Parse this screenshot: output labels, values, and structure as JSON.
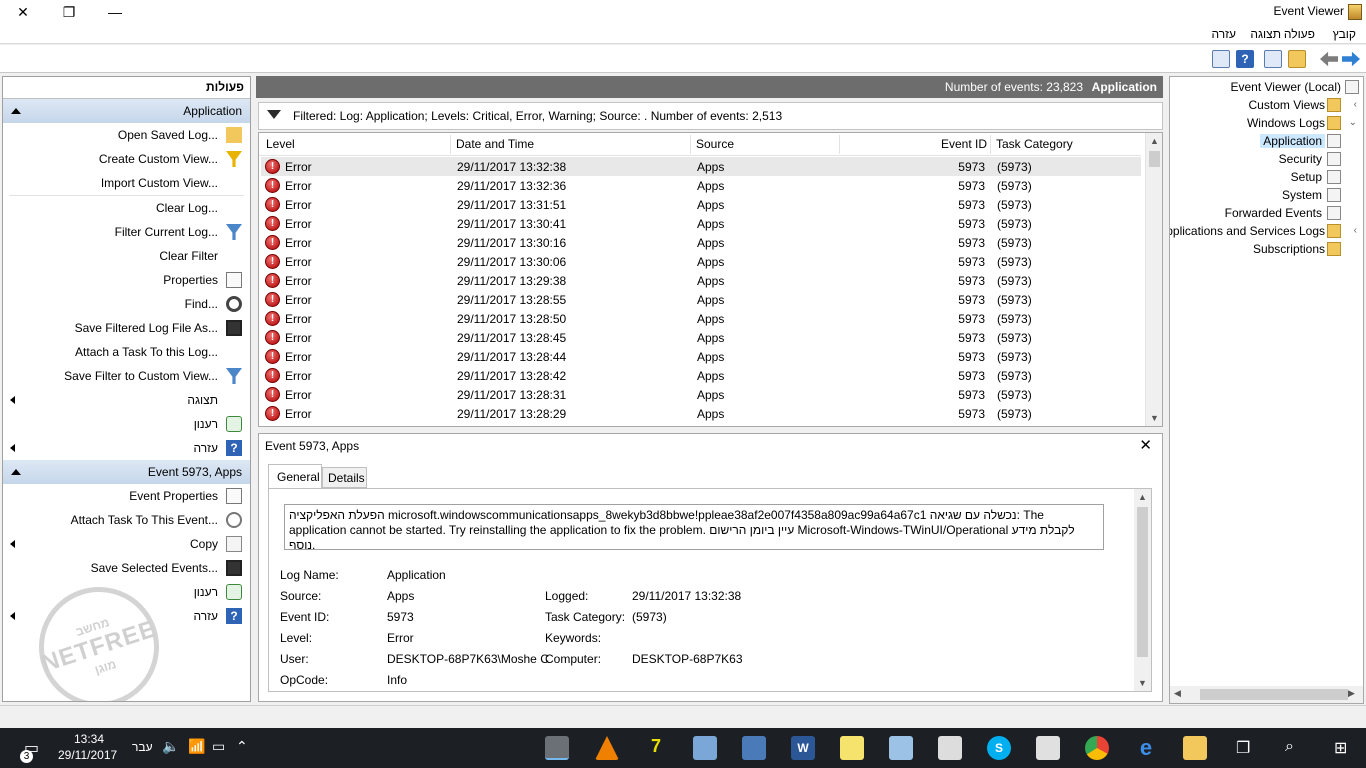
{
  "window": {
    "title": "Event Viewer",
    "minimize_glyph": "—",
    "restore_glyph": "❐",
    "close_glyph": "✕"
  },
  "menu": [
    "קובץ",
    "פעולה",
    "תצוגה",
    "עזרה"
  ],
  "actions": {
    "header": "פעולות",
    "section1_title": "Application",
    "section1_items": [
      "Open Saved Log...",
      "Create Custom View...",
      "Import Custom View...",
      "Clear Log...",
      "Filter Current Log...",
      "Clear Filter",
      "Properties",
      "Find...",
      "Save Filtered Log File As...",
      "Attach a Task To this Log...",
      "Save Filter to Custom View..."
    ],
    "view_label": "תצוגה",
    "refresh_label": "רענון",
    "help_label": "עזרה",
    "section2_title": "Event 5973, Apps",
    "section2_items": [
      "Event Properties",
      "Attach Task To This Event...",
      "Copy",
      "Save Selected Events..."
    ],
    "refresh2_label": "רענון",
    "help2_label": "עזרה",
    "watermark_top": "מחשב",
    "watermark_mid": "NETFREE",
    "watermark_bottom": "מוגן"
  },
  "log_header": {
    "count_text": "Number of events: 23,823",
    "log_name": "Application"
  },
  "filter_text": "Filtered: Log: Application; Levels: Critical, Error, Warning; Source: . Number of events: 2,513",
  "columns": [
    "Level",
    "Date and Time",
    "Source",
    "Event ID",
    "Task Category"
  ],
  "events": [
    [
      "Error",
      "29/11/2017 13:32:38",
      "Apps",
      "5973",
      "(5973)"
    ],
    [
      "Error",
      "29/11/2017 13:32:36",
      "Apps",
      "5973",
      "(5973)"
    ],
    [
      "Error",
      "29/11/2017 13:31:51",
      "Apps",
      "5973",
      "(5973)"
    ],
    [
      "Error",
      "29/11/2017 13:30:41",
      "Apps",
      "5973",
      "(5973)"
    ],
    [
      "Error",
      "29/11/2017 13:30:16",
      "Apps",
      "5973",
      "(5973)"
    ],
    [
      "Error",
      "29/11/2017 13:30:06",
      "Apps",
      "5973",
      "(5973)"
    ],
    [
      "Error",
      "29/11/2017 13:29:38",
      "Apps",
      "5973",
      "(5973)"
    ],
    [
      "Error",
      "29/11/2017 13:28:55",
      "Apps",
      "5973",
      "(5973)"
    ],
    [
      "Error",
      "29/11/2017 13:28:50",
      "Apps",
      "5973",
      "(5973)"
    ],
    [
      "Error",
      "29/11/2017 13:28:45",
      "Apps",
      "5973",
      "(5973)"
    ],
    [
      "Error",
      "29/11/2017 13:28:44",
      "Apps",
      "5973",
      "(5973)"
    ],
    [
      "Error",
      "29/11/2017 13:28:42",
      "Apps",
      "5973",
      "(5973)"
    ],
    [
      "Error",
      "29/11/2017 13:28:31",
      "Apps",
      "5973",
      "(5973)"
    ],
    [
      "Error",
      "29/11/2017 13:28:29",
      "Apps",
      "5973",
      "(5973)"
    ]
  ],
  "detail": {
    "title": "Event 5973, Apps",
    "tab_general": "General",
    "tab_details": "Details",
    "description": "הפעלת האפליקציה microsoft.windowscommunicationsapps_8wekyb3d8bbwe!ppleae38af2e007f4358a809ac99a64a67c1 נכשלה עם שגיאה: The application cannot be started. Try reinstalling the application to fix the problem. עיין ביומן הרישום Microsoft-Windows-TWinUI/Operational לקבלת מידע נוסף.",
    "log_name_label": "Log Name:",
    "log_name": "Application",
    "source_label": "Source:",
    "source": "Apps",
    "logged_label": "Logged:",
    "logged": "29/11/2017 13:32:38",
    "event_id_label": "Event ID:",
    "event_id": "5973",
    "task_category_label": "Task Category:",
    "task_category": "(5973)",
    "level_label": "Level:",
    "level": "Error",
    "keywords_label": "Keywords:",
    "user_label": "User:",
    "user": "DESKTOP-68P7K63\\Moshe C",
    "computer_label": "Computer:",
    "computer": "DESKTOP-68P7K63",
    "opcode_label": "OpCode:",
    "opcode": "Info"
  },
  "tree": {
    "root": "Event Viewer (Local)",
    "custom_views": "Custom Views",
    "windows_logs": "Windows Logs",
    "application": "Application",
    "security": "Security",
    "setup": "Setup",
    "system": "System",
    "forwarded": "Forwarded Events",
    "app_services": "Applications and Services Logs",
    "subscriptions": "Subscriptions"
  },
  "taskbar": {
    "time": "13:34",
    "date": "29/11/2017",
    "language": "עבר",
    "notifications": "3"
  }
}
